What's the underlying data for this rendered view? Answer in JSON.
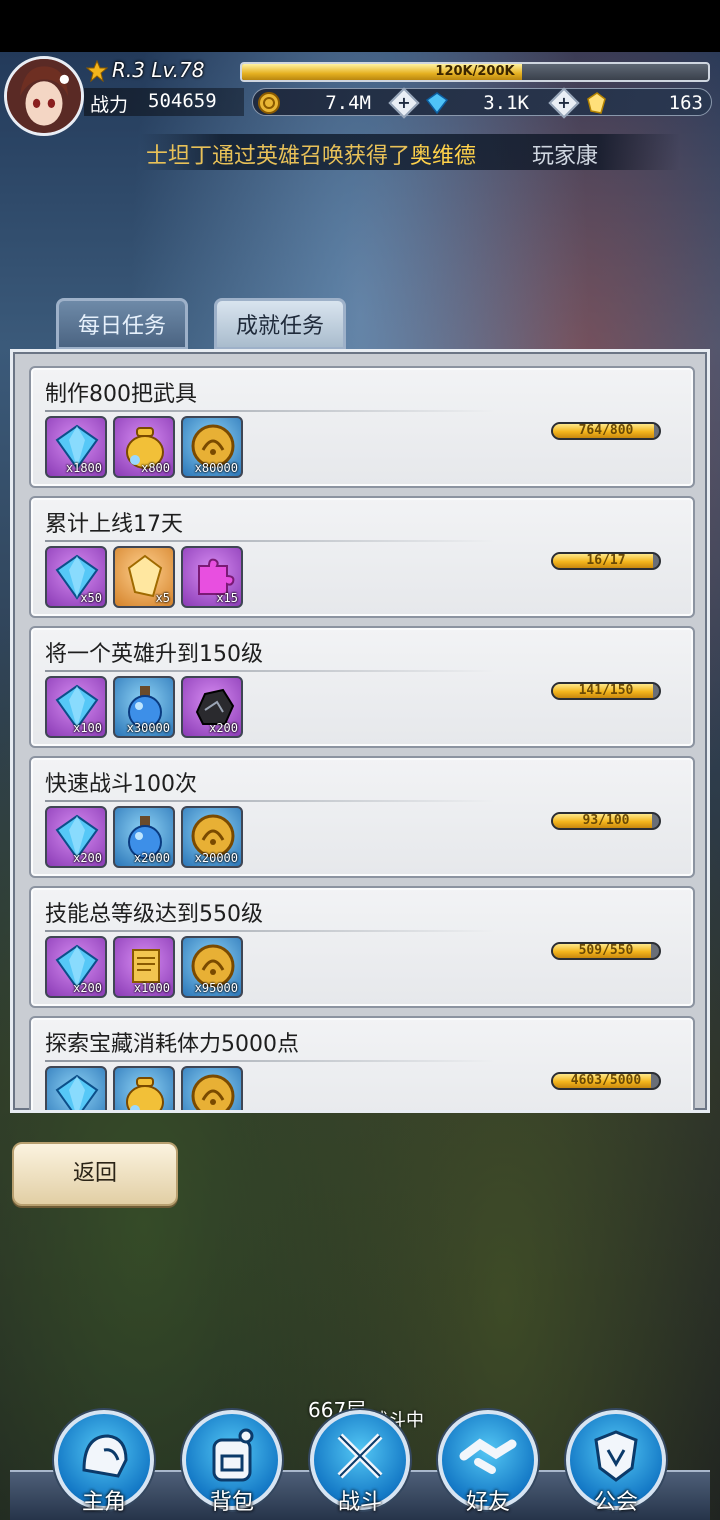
{
  "header": {
    "rank_level": "R.3 Lv.78",
    "xp_text": "120K/200K",
    "xp_fraction": 0.6,
    "power_label": "战力",
    "power_value": "504659",
    "gold": "7.4M",
    "diamonds": "3.1K",
    "crystals": "163"
  },
  "marquee": {
    "part1": "士坦丁通过英雄召唤获得了",
    "part2": "奥维德",
    "part3": "玩家康"
  },
  "tabs": {
    "daily": "每日任务",
    "achievement": "成就任务"
  },
  "tasks": [
    {
      "title": "制作800把武具",
      "progress_text": "764/800",
      "progress_fraction": 0.955,
      "rewards": [
        {
          "icon": "diamond-icon",
          "qty": "x1800",
          "rarity": "purple"
        },
        {
          "icon": "gold-bag-icon",
          "qty": "x800",
          "rarity": "purple"
        },
        {
          "icon": "gold-coin-icon",
          "qty": "x80000",
          "rarity": "blue"
        }
      ]
    },
    {
      "title": "累计上线17天",
      "progress_text": "16/17",
      "progress_fraction": 0.941,
      "rewards": [
        {
          "icon": "diamond-icon",
          "qty": "x50",
          "rarity": "purple"
        },
        {
          "icon": "crystal-icon",
          "qty": "x5",
          "rarity": "orange"
        },
        {
          "icon": "puzzle-piece-icon",
          "qty": "x15",
          "rarity": "purple"
        }
      ]
    },
    {
      "title": "将一个英雄升到150级",
      "progress_text": "141/150",
      "progress_fraction": 0.94,
      "rewards": [
        {
          "icon": "diamond-icon",
          "qty": "x100",
          "rarity": "purple"
        },
        {
          "icon": "exp-potion-icon",
          "qty": "x30000",
          "rarity": "blue"
        },
        {
          "icon": "ore-icon",
          "qty": "x200",
          "rarity": "purple"
        }
      ]
    },
    {
      "title": "快速战斗100次",
      "progress_text": "93/100",
      "progress_fraction": 0.93,
      "rewards": [
        {
          "icon": "diamond-icon",
          "qty": "x200",
          "rarity": "purple"
        },
        {
          "icon": "exp-potion-icon",
          "qty": "x2000",
          "rarity": "blue"
        },
        {
          "icon": "gold-coin-icon",
          "qty": "x20000",
          "rarity": "blue"
        }
      ]
    },
    {
      "title": "技能总等级达到550级",
      "progress_text": "509/550",
      "progress_fraction": 0.925,
      "rewards": [
        {
          "icon": "diamond-icon",
          "qty": "x200",
          "rarity": "purple"
        },
        {
          "icon": "scroll-icon",
          "qty": "x1000",
          "rarity": "purple"
        },
        {
          "icon": "gold-coin-icon",
          "qty": "x95000",
          "rarity": "blue"
        }
      ]
    },
    {
      "title": "探索宝藏消耗体力5000点",
      "progress_text": "4603/5000",
      "progress_fraction": 0.92,
      "rewards": [
        {
          "icon": "diamond-icon",
          "qty": "",
          "rarity": "blue"
        },
        {
          "icon": "gold-bag-icon",
          "qty": "",
          "rarity": "blue"
        },
        {
          "icon": "gold-coin-icon",
          "qty": "",
          "rarity": "blue"
        }
      ]
    }
  ],
  "back_button": "返回",
  "battle": {
    "floor": "667层",
    "status": "战斗中"
  },
  "nav": [
    {
      "label": "主角",
      "icon": "helmet-icon"
    },
    {
      "label": "背包",
      "icon": "backpack-icon"
    },
    {
      "label": "战斗",
      "icon": "crossed-swords-icon"
    },
    {
      "label": "好友",
      "icon": "handshake-icon"
    },
    {
      "label": "公会",
      "icon": "guild-crest-icon"
    }
  ]
}
